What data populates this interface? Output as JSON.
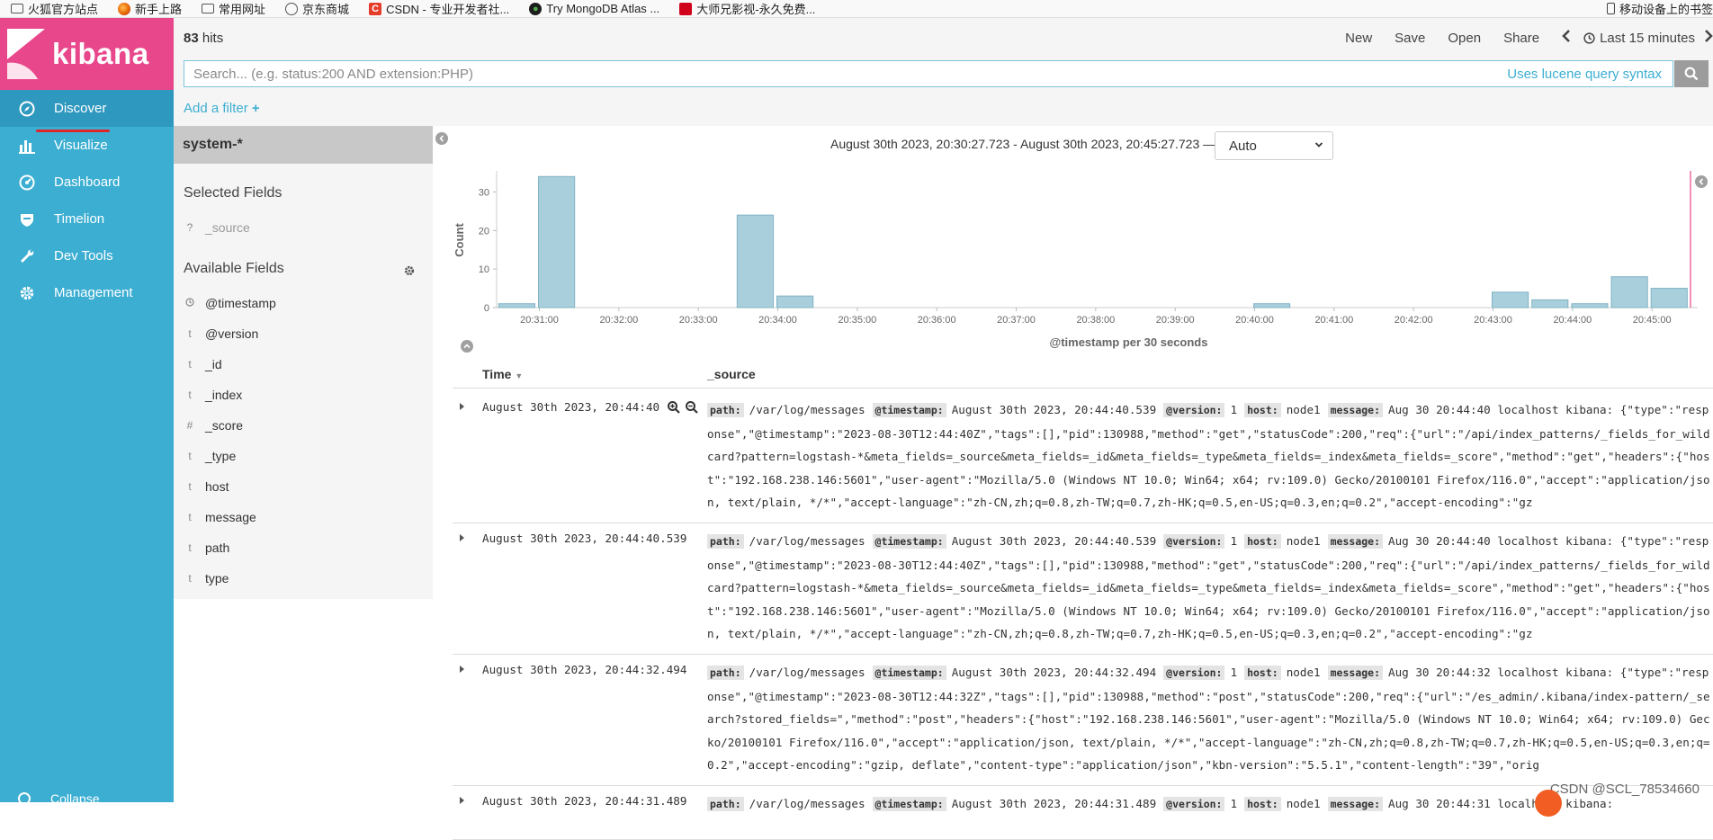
{
  "bookmarks": [
    {
      "label": "火狐官方站点",
      "icon": "folder-icon"
    },
    {
      "label": "新手上路",
      "icon": "firefox-icon"
    },
    {
      "label": "常用网址",
      "icon": "folder-icon"
    },
    {
      "label": "京东商城",
      "icon": "globe-icon"
    },
    {
      "label": "CSDN - 专业开发者社...",
      "icon": "csdn-icon"
    },
    {
      "label": "Try MongoDB Atlas ...",
      "icon": "mongodb-icon"
    },
    {
      "label": "大师兄影视-永久免费...",
      "icon": "movie-icon"
    }
  ],
  "bookmarks_right": "移动设备上的书签",
  "sidebar": {
    "logo": "kibana",
    "items": [
      {
        "label": "Discover",
        "icon": "compass-icon"
      },
      {
        "label": "Visualize",
        "icon": "bar-chart-icon"
      },
      {
        "label": "Dashboard",
        "icon": "dashboard-icon"
      },
      {
        "label": "Timelion",
        "icon": "shield-icon"
      },
      {
        "label": "Dev Tools",
        "icon": "wrench-icon"
      },
      {
        "label": "Management",
        "icon": "gear-icon"
      }
    ],
    "collapse_label": "Collapse"
  },
  "topbar": {
    "hits_count": "83",
    "hits_label": " hits",
    "new": "New",
    "save": "Save",
    "open": "Open",
    "share": "Share",
    "time_range": "Last 15 minutes"
  },
  "search": {
    "placeholder": "Search... (e.g. status:200 AND extension:PHP)",
    "lucene": "Uses lucene query syntax"
  },
  "filter": {
    "add": "Add a filter"
  },
  "fields": {
    "index_pattern": "system-*",
    "selected_title": "Selected Fields",
    "selected": [
      {
        "type": "?",
        "name": "_source"
      }
    ],
    "available_title": "Available Fields",
    "available": [
      {
        "type": "clock",
        "name": "@timestamp"
      },
      {
        "type": "t",
        "name": "@version"
      },
      {
        "type": "t",
        "name": "_id"
      },
      {
        "type": "t",
        "name": "_index"
      },
      {
        "type": "#",
        "name": "_score"
      },
      {
        "type": "t",
        "name": "_type"
      },
      {
        "type": "t",
        "name": "host"
      },
      {
        "type": "t",
        "name": "message"
      },
      {
        "type": "t",
        "name": "path"
      },
      {
        "type": "t",
        "name": "type"
      }
    ]
  },
  "chart_header": {
    "range": "August 30th 2023, 20:30:27.723 - August 30th 2023, 20:45:27.723 —",
    "interval": "Auto"
  },
  "chart_data": {
    "type": "bar",
    "xlabel": "@timestamp per 30 seconds",
    "ylabel": "Count",
    "ylim": [
      0,
      35
    ],
    "yticks": [
      0,
      10,
      20,
      30
    ],
    "xticks": [
      "20:31:00",
      "20:32:00",
      "20:33:00",
      "20:34:00",
      "20:35:00",
      "20:36:00",
      "20:37:00",
      "20:38:00",
      "20:39:00",
      "20:40:00",
      "20:41:00",
      "20:42:00",
      "20:43:00",
      "20:44:00",
      "20:45:00"
    ],
    "bars": [
      {
        "t": "20:30:30",
        "value": 1
      },
      {
        "t": "20:31:00",
        "value": 34
      },
      {
        "t": "20:33:30",
        "value": 24
      },
      {
        "t": "20:34:00",
        "value": 3
      },
      {
        "t": "20:40:00",
        "value": 1
      },
      {
        "t": "20:43:00",
        "value": 4
      },
      {
        "t": "20:43:30",
        "value": 2
      },
      {
        "t": "20:44:00",
        "value": 1
      },
      {
        "t": "20:44:30",
        "value": 8
      },
      {
        "t": "20:45:00",
        "value": 5
      }
    ],
    "grid": false,
    "legend": "none"
  },
  "table": {
    "time_header": "Time",
    "source_header": "_source",
    "rows": [
      {
        "time": "August 30th 2023, 20:44:40",
        "path": "/var/log/messages",
        "timestamp": "August 30th 2023, 20:44:40.539",
        "version": "1",
        "host": "node1",
        "message": "Aug 30 20:44:40 localhost kibana: {\"type\":\"response\",\"@timestamp\":\"2023-08-30T12:44:40Z\",\"tags\":[],\"pid\":130988,\"method\":\"get\",\"statusCode\":200,\"req\":{\"url\":\"/api/index_patterns/_fields_for_wildcard?pattern=logstash-*&meta_fields=_source&meta_fields=_id&meta_fields=_type&meta_fields=_index&meta_fields=_score\",\"method\":\"get\",\"headers\":{\"host\":\"192.168.238.146:5601\",\"user-agent\":\"Mozilla/5.0 (Windows NT 10.0; Win64; x64; rv:109.0) Gecko/20100101 Firefox/116.0\",\"accept\":\"application/json, text/plain, */*\",\"accept-language\":\"zh-CN,zh;q=0.8,zh-TW;q=0.7,zh-HK;q=0.5,en-US;q=0.3,en;q=0.2\",\"accept-encoding\":\"gz"
      },
      {
        "time": "August 30th 2023, 20:44:40.539",
        "path": "/var/log/messages",
        "timestamp": "August 30th 2023, 20:44:40.539",
        "version": "1",
        "host": "node1",
        "message": "Aug 30 20:44:40 localhost kibana: {\"type\":\"response\",\"@timestamp\":\"2023-08-30T12:44:40Z\",\"tags\":[],\"pid\":130988,\"method\":\"get\",\"statusCode\":200,\"req\":{\"url\":\"/api/index_patterns/_fields_for_wildcard?pattern=logstash-*&meta_fields=_source&meta_fields=_id&meta_fields=_type&meta_fields=_index&meta_fields=_score\",\"method\":\"get\",\"headers\":{\"host\":\"192.168.238.146:5601\",\"user-agent\":\"Mozilla/5.0 (Windows NT 10.0; Win64; x64; rv:109.0) Gecko/20100101 Firefox/116.0\",\"accept\":\"application/json, text/plain, */*\",\"accept-language\":\"zh-CN,zh;q=0.8,zh-TW;q=0.7,zh-HK;q=0.5,en-US;q=0.3,en;q=0.2\",\"accept-encoding\":\"gz"
      },
      {
        "time": "August 30th 2023, 20:44:32.494",
        "path": "/var/log/messages",
        "timestamp": "August 30th 2023, 20:44:32.494",
        "version": "1",
        "host": "node1",
        "message": "Aug 30 20:44:32 localhost kibana: {\"type\":\"response\",\"@timestamp\":\"2023-08-30T12:44:32Z\",\"tags\":[],\"pid\":130988,\"method\":\"post\",\"statusCode\":200,\"req\":{\"url\":\"/es_admin/.kibana/index-pattern/_search?stored_fields=\",\"method\":\"post\",\"headers\":{\"host\":\"192.168.238.146:5601\",\"user-agent\":\"Mozilla/5.0 (Windows NT 10.0; Win64; x64; rv:109.0) Gecko/20100101 Firefox/116.0\",\"accept\":\"application/json, text/plain, */*\",\"accept-language\":\"zh-CN,zh;q=0.8,zh-TW;q=0.7,zh-HK;q=0.5,en-US;q=0.3,en;q=0.2\",\"accept-encoding\":\"gzip, deflate\",\"content-type\":\"application/json\",\"kbn-version\":\"5.5.1\",\"content-length\":\"39\",\"orig"
      },
      {
        "time": "August 30th 2023, 20:44:31.489",
        "path": "/var/log/messages",
        "timestamp": "August 30th 2023, 20:44:31.489",
        "version": "1",
        "host": "node1",
        "message": "Aug 30 20:44:31 localhost kibana:"
      }
    ],
    "keys": {
      "path": "path:",
      "timestamp": "@timestamp:",
      "version": "@version:",
      "host": "host:",
      "message": "message:"
    }
  },
  "watermark": "CSDN @SCL_78534660",
  "colors": {
    "sidebar": "#3caed2",
    "logo_bg": "#e8488b",
    "active_nav": "#2e98be",
    "bar_fill": "#a9cfdc",
    "bar_stroke": "#7fb3c5",
    "accent": "#3caed2"
  }
}
